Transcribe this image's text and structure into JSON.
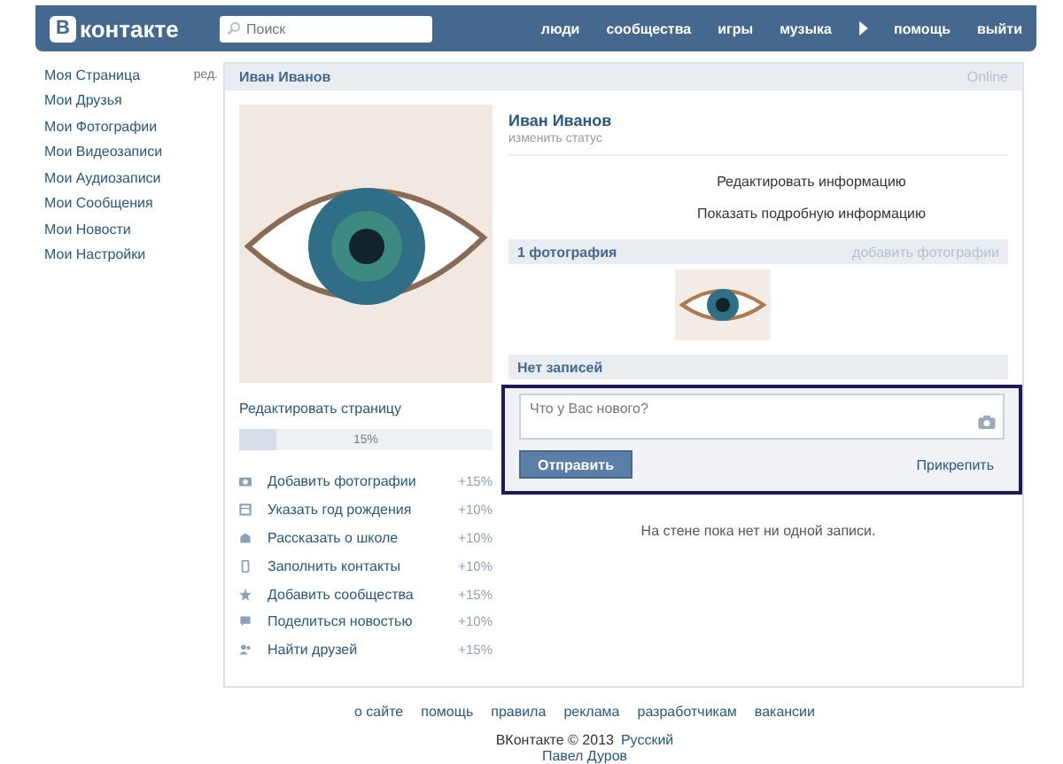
{
  "header": {
    "logo": {
      "letter": "В",
      "text": "контакте"
    },
    "search": {
      "placeholder": "Поиск"
    },
    "nav": [
      {
        "label": "люди",
        "kind": "link"
      },
      {
        "label": "сообщества",
        "kind": "link"
      },
      {
        "label": "игры",
        "kind": "link"
      },
      {
        "label": "музыка",
        "kind": "link"
      },
      {
        "kind": "play"
      },
      {
        "label": "помощь",
        "kind": "link"
      },
      {
        "label": "выйти",
        "kind": "link"
      }
    ]
  },
  "sidebar": {
    "items": [
      {
        "label": "Моя Страница",
        "edit": "ред."
      },
      {
        "label": "Мои Друзья"
      },
      {
        "label": "Мои Фотографии"
      },
      {
        "label": "Мои Видеозаписи"
      },
      {
        "label": "Мои Аудиозаписи"
      },
      {
        "label": "Мои Сообщения"
      },
      {
        "label": "Мои Новости"
      },
      {
        "label": "Мои Настройки"
      }
    ]
  },
  "profile": {
    "header_name": "Иван Иванов",
    "online": "Online",
    "edit_page": "Редактировать страницу",
    "progress": {
      "level": 0.15,
      "reading": "15%"
    },
    "tasks": [
      {
        "kind": "photo",
        "label": "Добавить фотографии",
        "bonus": "+15%"
      },
      {
        "kind": "birthday",
        "label": "Указать год рождения",
        "bonus": "+10%"
      },
      {
        "kind": "school",
        "label": "Рассказать о школе",
        "bonus": "+10%"
      },
      {
        "kind": "contacts",
        "label": "Заполнить контакты",
        "bonus": "+10%"
      },
      {
        "kind": "groups",
        "label": "Добавить сообщества",
        "bonus": "+15%"
      },
      {
        "kind": "news",
        "label": "Поделиться новостью",
        "bonus": "+10%"
      },
      {
        "kind": "friends",
        "label": "Найти друзей",
        "bonus": "+15%"
      }
    ],
    "name": "Иван Иванов",
    "status_link": "изменить статус",
    "info_links": [
      "Редактировать информацию",
      "Показать подробную информацию"
    ],
    "photos": {
      "title": "1 фотография",
      "add_link": "добавить фотографии"
    },
    "wall": {
      "title": "Нет записей",
      "post": {
        "placeholder": "Что у Вас нового?",
        "send": "Отправить",
        "attach": "Прикрепить"
      },
      "empty": "На стене пока нет ни одной записи."
    }
  },
  "footer": {
    "links": [
      "о сайте",
      "помощь",
      "правила",
      "реклама",
      "разработчикам",
      "вакансии"
    ],
    "copyright": "ВКонтакте © 2013",
    "language": "Русский",
    "author": "Павел Дуров"
  }
}
